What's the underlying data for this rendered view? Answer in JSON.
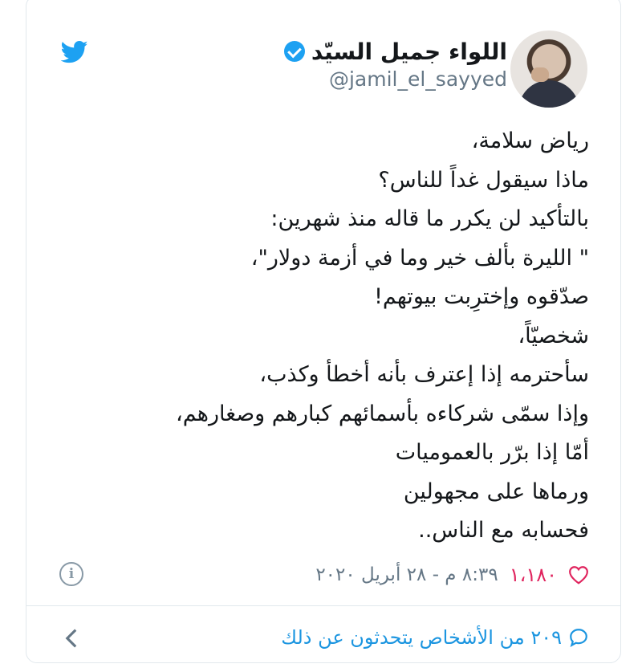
{
  "author": {
    "name": "اللواء جميل السيّد",
    "handle": "@jamil_el_sayyed",
    "verified": true
  },
  "tweet": {
    "lines": [
      "رياض سلامة،",
      "ماذا سيقول غداً للناس؟",
      "بالتأكيد لن يكرر ما قاله منذ شهرين:",
      "\" الليرة بألف خير وما في أزمة دولار\"،",
      "صدّقوه وإخترِبت بيوتهم!",
      "شخصيّاً،",
      "سأحترمه إذا إعترف بأنه أخطأ وكذب،",
      "وإذا سمّى شركاءه بأسمائهم كبارهم وصغارهم،",
      "أمّا إذا برّر بالعموميات",
      "ورماها على مجهولين",
      "فحسابه مع الناس.."
    ]
  },
  "meta": {
    "likes": "١،١٨٠",
    "timestamp": "٨:٣٩ م - ٢٨ أبريل ٢٠٢٠"
  },
  "footer": {
    "people_talking": "٢٠٩ من الأشخاص يتحدثون عن ذلك"
  },
  "colors": {
    "accent": "#1da1f2",
    "like": "#e0245e",
    "secondary_text": "#657786"
  },
  "icons": [
    "twitter-bird-icon",
    "verified-badge-icon",
    "heart-icon",
    "info-icon",
    "comment-bubble-icon",
    "chevron-left-icon"
  ]
}
